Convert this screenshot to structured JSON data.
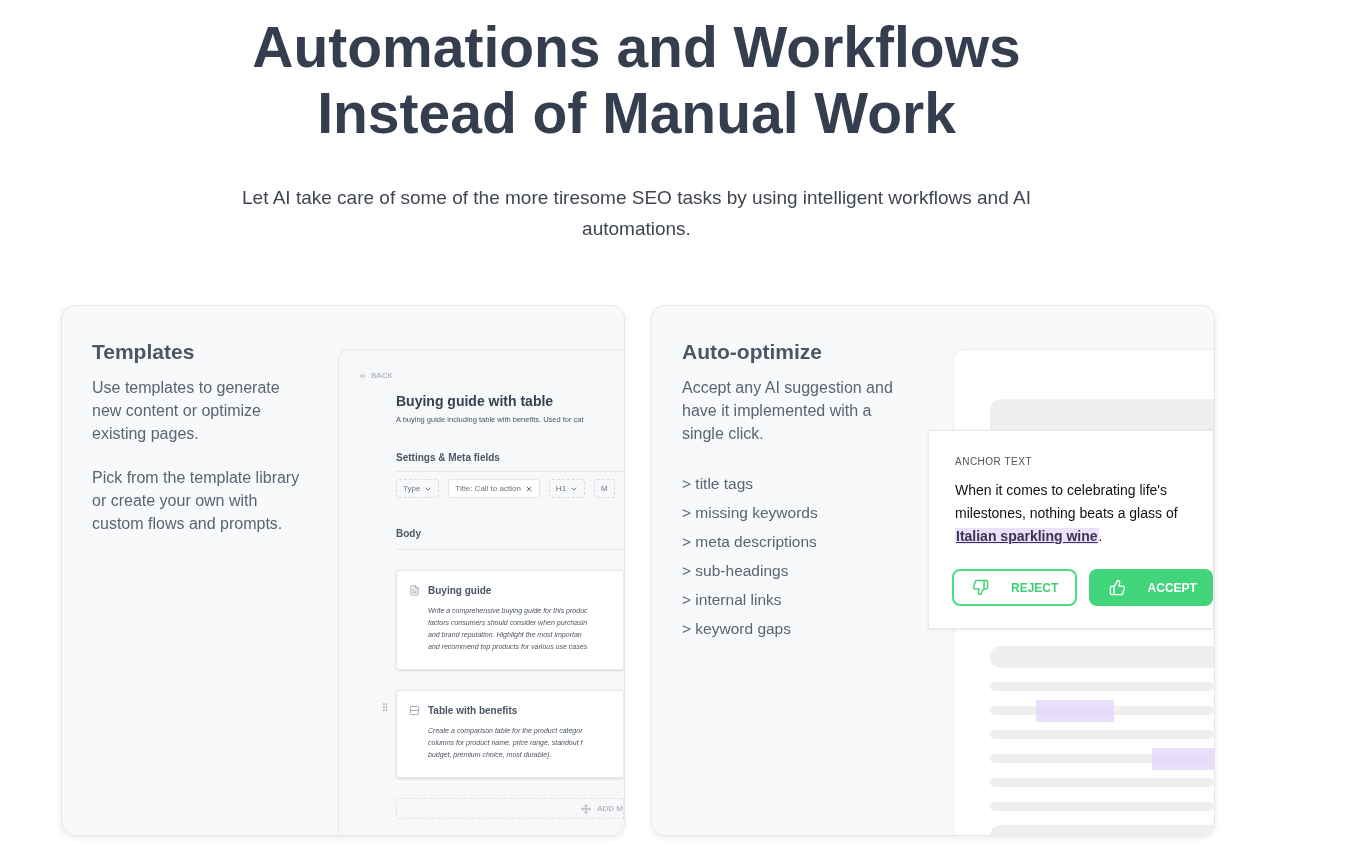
{
  "heading": {
    "lines": [
      "Automations and Workflows",
      "Instead of Manual Work"
    ]
  },
  "intro": "Let AI take care of some of the more tiresome SEO tasks by using intelligent workflows and AI automations.",
  "cards": [
    {
      "kind": "templates",
      "title": "Templates",
      "paragraphs": [
        "Use templates to generate new content or optimize existing pages.",
        "Pick from the template library or create your own with custom flows and prompts."
      ],
      "mockup": {
        "back": "BACK",
        "title": "Buying guide with table",
        "description": "A buying guide including table with benefits. Used for cat",
        "settings_heading": "Settings & Meta fields",
        "chips": [
          {
            "label": "Type",
            "kind": "dropdown"
          },
          {
            "label": "Title: Call to action",
            "kind": "removable"
          },
          {
            "label": "H1",
            "kind": "dropdown"
          },
          {
            "label": "M",
            "kind": "plain"
          }
        ],
        "body_heading": "Body",
        "blocks": [
          {
            "kind": "document",
            "title": "Buying guide",
            "drag_handle": false,
            "lines": [
              "Write a comprehensive buying guide for this produc",
              "factors consumers should consider when purchasin",
              "and brand reputation. Highlight the most importan",
              "and recommend top products for various use cases"
            ]
          },
          {
            "kind": "table",
            "title": "Table with benefits",
            "drag_handle": true,
            "lines": [
              "Create a comparison table for the product categor",
              "columns for product name, price range, standout f",
              "budget, premium choice, most durable)."
            ]
          }
        ],
        "add_label": "ADD M"
      }
    },
    {
      "kind": "auto_optimize",
      "title": "Auto-optimize",
      "paragraphs": [
        "Accept any AI suggestion and have it implemented with a single click."
      ],
      "bullets": [
        "> title tags",
        "> missing keywords",
        "> meta descriptions",
        "> sub-headings",
        "> internal links",
        "> keyword gaps"
      ],
      "popup": {
        "label": "ANCHOR TEXT",
        "text_before": "When it comes to celebrating life's milestones, nothing beats a glass of ",
        "link": "Italian sparkling wine",
        "text_after": ".",
        "buttons": [
          {
            "label": "REJECT",
            "kind": "reject"
          },
          {
            "label": "ACCEPT",
            "kind": "accept"
          }
        ]
      }
    }
  ]
}
